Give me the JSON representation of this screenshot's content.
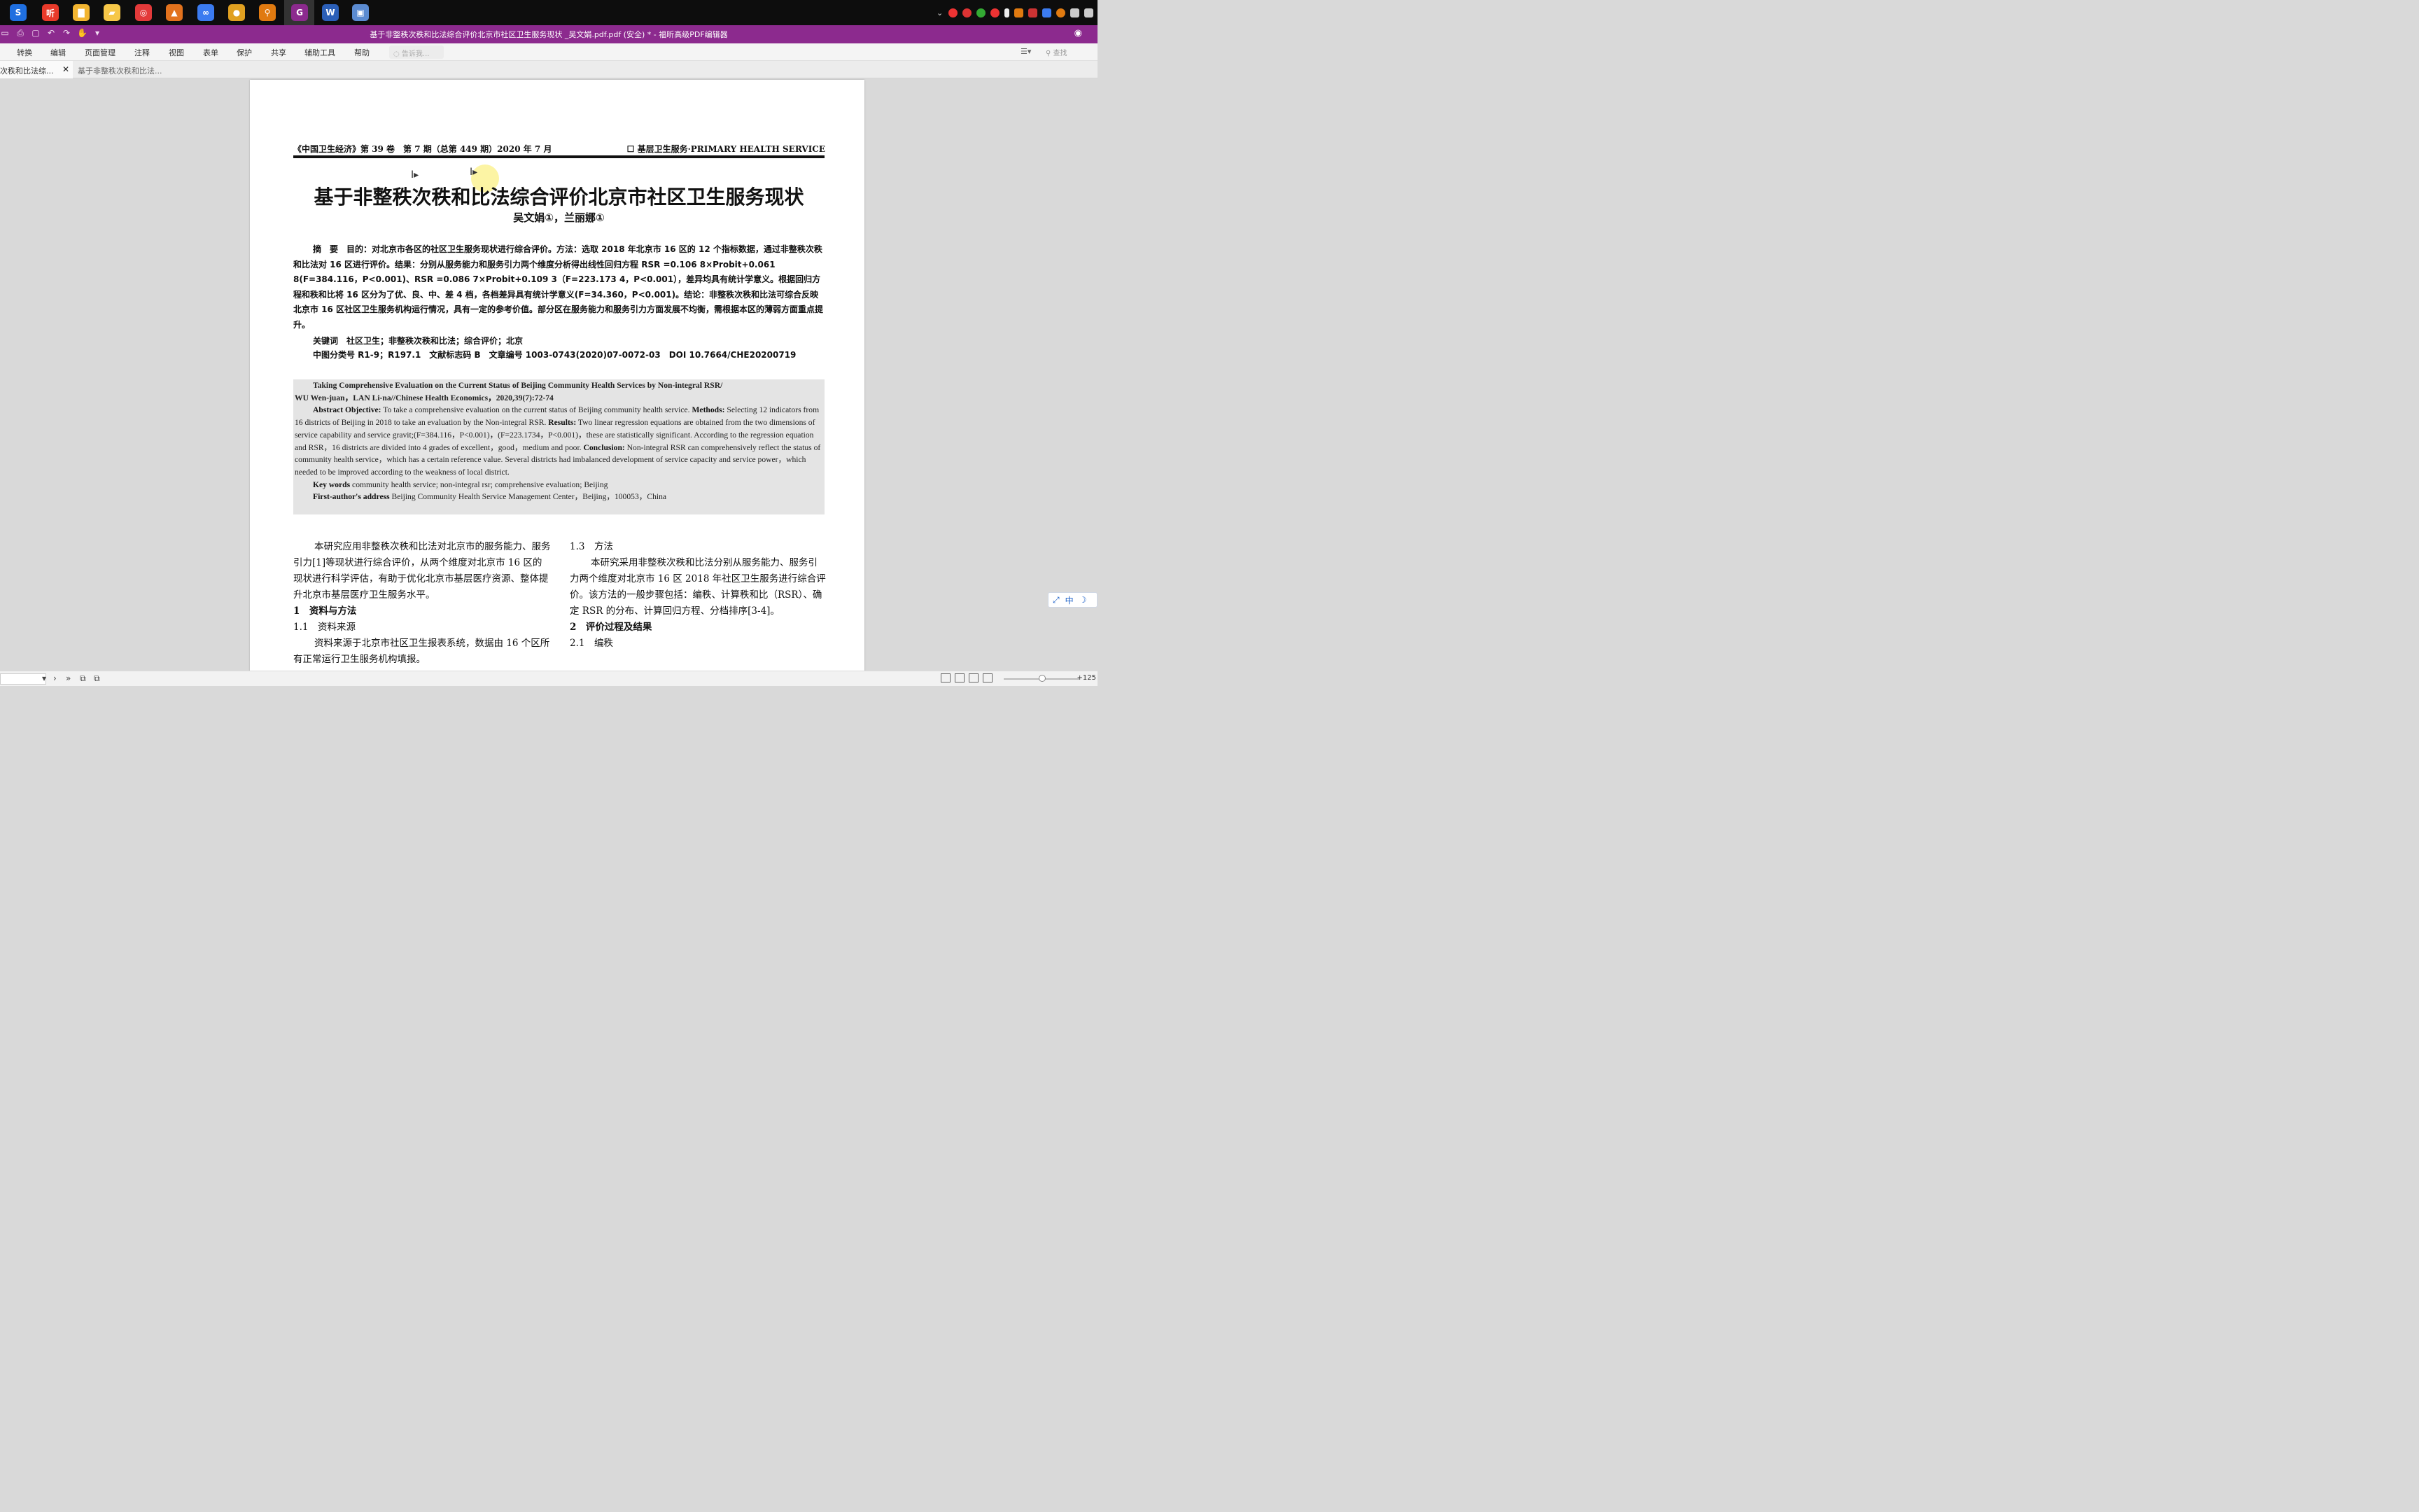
{
  "taskbar": {
    "icons": [
      {
        "name": "sogou",
        "glyph": "S",
        "color": "#1f6fe0"
      },
      {
        "name": "ting",
        "glyph": "听",
        "color": "#e83a2a"
      },
      {
        "name": "files",
        "glyph": "▇",
        "color": "#f2b531"
      },
      {
        "name": "folder",
        "glyph": "▰",
        "color": "#f6c748"
      },
      {
        "name": "netease-music",
        "glyph": "◎",
        "color": "#e33a3a"
      },
      {
        "name": "matlab",
        "glyph": "▲",
        "color": "#e2721d"
      },
      {
        "name": "baidu-pan",
        "glyph": "∞",
        "color": "#3b7bf0"
      },
      {
        "name": "chrome",
        "glyph": "●",
        "color": "#e0a020"
      },
      {
        "name": "search-tool",
        "glyph": "⚲",
        "color": "#e07a10"
      },
      {
        "name": "foxit-pdf",
        "glyph": "G",
        "color": "#8c2a8e"
      },
      {
        "name": "word",
        "glyph": "W",
        "color": "#2b5fb8"
      },
      {
        "name": "remote",
        "glyph": "▣",
        "color": "#5b8bd0"
      }
    ]
  },
  "titlebar": {
    "title": "基于非整秩次秩和比法综合评价北京市社区卫生服务现状 _吴文娟.pdf.pdf (安全) * - 福昕高级PDF编辑器"
  },
  "menu": {
    "items": [
      "转换",
      "编辑",
      "页面管理",
      "注释",
      "视图",
      "表单",
      "保护",
      "共享",
      "辅助工具",
      "帮助"
    ],
    "tellme_placeholder": "告诉我...",
    "search_label": "查找"
  },
  "tabs": {
    "active": "次秩和比法综...",
    "inactive": "基于非整秩次秩和比法..."
  },
  "document": {
    "header_left": "《中国卫生经济》第 39 卷　第 7 期（总第 449 期）2020 年 7 月",
    "header_right": "☐ 基层卫生服务·PRIMARY HEALTH SERVICE",
    "title": "基于非整秩次秩和比法综合评价北京市社区卫生服务现状",
    "authors": "吴文娟①，兰丽娜①",
    "abstract": "摘　要　目的：对北京市各区的社区卫生服务现状进行综合评价。方法：选取 2018 年北京市 16 区的 12 个指标数据，通过非整秩次秩和比法对 16 区进行评价。结果：分别从服务能力和服务引力两个维度分析得出线性回归方程 RSR =0.106 8×Probit+0.061 8(F=384.116，P<0.001)、RSR =0.086 7×Probit+0.109 3（F=223.173 4，P<0.001），差异均具有统计学意义。根据回归方程和秩和比将 16 区分为了优、良、中、差 4 档，各档差异具有统计学意义(F=34.360，P<0.001)。结论：非整秩次秩和比法可综合反映北京市 16 区社区卫生服务机构运行情况，具有一定的参考价值。部分区在服务能力和服务引力方面发展不均衡，需根据本区的薄弱方面重点提升。",
    "keywords": "关键词　社区卫生；非整秩次秩和比法；综合评价；北京",
    "classification": "中图分类号 R1-9；R197.1　文献标志码 B　文章编号 1003-0743(2020)07-0072-03　DOI 10.7664/CHE20200719",
    "en_title": "Taking Comprehensive Evaluation on the Current Status of Beijing Community Health Services by Non-integral RSR/",
    "en_authors": "WU Wen-juan，LAN Li-na//Chinese Health Economics，2020,39(7):72-74",
    "en_abstract_label": "Abstract Objective:",
    "en_abstract_1": "To take a comprehensive evaluation on the current status of Beijing community health service.",
    "en_methods_label": "Methods:",
    "en_methods": "Selecting 12 indicators from 16 districts of Beijing in 2018 to take an evaluation by the Non-integral RSR.",
    "en_results_label": "Results:",
    "en_results": "Two linear regression equations are obtained from the two dimensions of service capability and service gravit;(F=384.116，P<0.001)，(F=223.1734，P<0.001)，these are statistically significant. According to the regression equation and RSR，16 districts are divided into 4 grades of excellent，good，medium and poor.",
    "en_conclusion_label": "Conclusion:",
    "en_conclusion": "Non-integral RSR can comprehensively reflect the status of community health service，which has a certain reference value. Several districts had imbalanced development of service capacity and service power，which needed to be improved according to the weakness of local district.",
    "en_keywords_label": "Key words",
    "en_keywords": "community health service; non-integral rsr; comprehensive evaluation; Beijing",
    "en_address_label": "First-author's address",
    "en_address": "Beijing Community Health Service Management Center，Beijing，100053，China",
    "left_intro": "本研究应用非整秩次秩和比法对北京市的服务能力、服务引力[1]等现状进行综合评价，从两个维度对北京市 16 区的现状进行科学评估，有助于优化北京市基层医疗资源、整体提升北京市基层医疗卫生服务水平。",
    "sec1": "1　资料与方法",
    "sec1_1": "1.1　资料来源",
    "sec1_1_text": "资料来源于北京市社区卫生报表系统，数据由 16 个区所有正常运行卫生服务机构填报。",
    "sec1_3": "1.3　方法",
    "sec1_3_text": "本研究采用非整秩次秩和比法分别从服务能力、服务引力两个维度对北京市 16 区 2018 年社区卫生服务进行综合评价。该方法的一般步骤包括：编秩、计算秩和比（RSR）、确定 RSR 的分布、计算回归方程、分档排序[3-4]。",
    "sec2": "2　评价过程及结果",
    "sec2_1": "2.1　编秩"
  },
  "status": {
    "zoom": "+125"
  },
  "ime": {
    "label": "中"
  }
}
